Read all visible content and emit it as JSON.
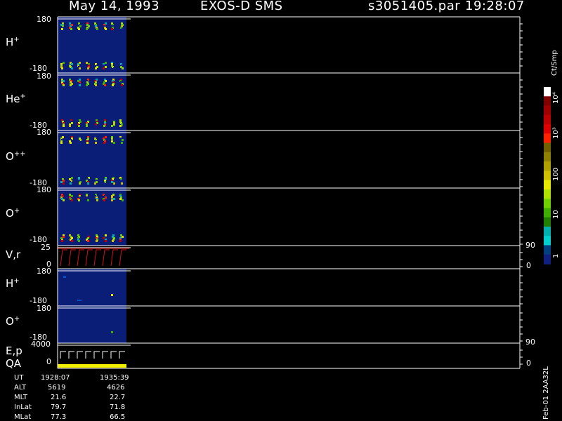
{
  "header": {
    "date": "May 14, 1993",
    "instrument": "EXOS-D SMS",
    "file": "s3051405.par",
    "time": "19:28:07"
  },
  "panels": [
    {
      "label": "H",
      "sup": "+",
      "top": "180",
      "bottom": "-180"
    },
    {
      "label": "He",
      "sup": "+",
      "top": "180",
      "bottom": "-180"
    },
    {
      "label": "O",
      "sup": "++",
      "top": "180",
      "bottom": "-180"
    },
    {
      "label": "O",
      "sup": "+",
      "top": "180",
      "bottom": "-180"
    },
    {
      "label": "V,r",
      "sup": "",
      "top": "25",
      "bottom": "0",
      "right_top": "90",
      "right_bottom": "0"
    },
    {
      "label": "H",
      "sup": "+",
      "top": "180",
      "bottom": "-180"
    },
    {
      "label": "O",
      "sup": "+",
      "top": "180",
      "bottom": "-180"
    },
    {
      "label": "E,p",
      "sup": "",
      "label2": "QA",
      "top": "4000",
      "bottom": "0",
      "right_top": "90",
      "right_bottom": "0"
    }
  ],
  "colorbar": {
    "title": "Ct/Smp",
    "labels": [
      "10⁴",
      "10³",
      "100",
      "10",
      "1"
    ],
    "colors": [
      "#ffffff",
      "#800000",
      "#a00000",
      "#c00000",
      "#e00000",
      "#ff2000",
      "#706000",
      "#908000",
      "#b0a000",
      "#d0c000",
      "#e8e800",
      "#b0e000",
      "#70d000",
      "#40b000",
      "#208000",
      "#00b0b0",
      "#00d0d0",
      "#004080",
      "#102080"
    ]
  },
  "footer": {
    "row_labels": [
      "UT",
      "ALT",
      "MLT",
      "InLat",
      "MLat"
    ],
    "col1": [
      "1928:07",
      "5619",
      "21.6",
      "79.7",
      "77.3"
    ],
    "col2": [
      "1935:39",
      "4626",
      "22.7",
      "71.8",
      "66.5"
    ],
    "stamp": "Feb-01 2AA32L"
  },
  "chart_data": {
    "type": "heatmap",
    "title": "May 14, 1993   EXOS-D SMS",
    "x_start": "1928:07",
    "x_end": "1935:39",
    "panels": [
      "H+",
      "He+",
      "O++",
      "O+",
      "V,r",
      "H+",
      "O+",
      "E,p QA"
    ],
    "y_ranges": [
      [
        -180,
        180
      ],
      [
        -180,
        180
      ],
      [
        -180,
        180
      ],
      [
        -180,
        180
      ],
      [
        0,
        25
      ],
      [
        -180,
        180
      ],
      [
        -180,
        180
      ],
      [
        0,
        4000
      ]
    ],
    "right_y_ranges": {
      "V,r": [
        0,
        90
      ],
      "E,p QA": [
        0,
        90
      ]
    },
    "colorscale": "Ct/Smp",
    "colorscale_range": [
      1,
      10000
    ],
    "log_scale": true,
    "data_fraction_of_axis": 0.15
  }
}
